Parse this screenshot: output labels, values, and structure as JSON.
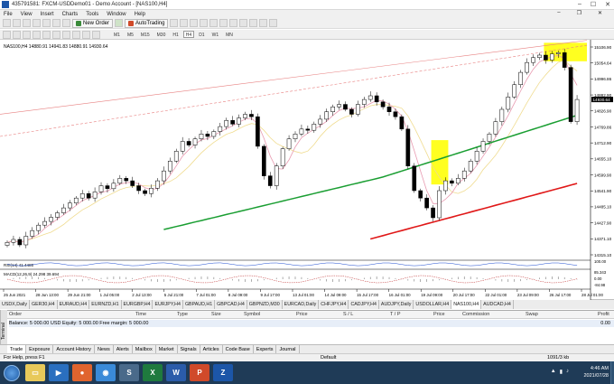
{
  "window": {
    "title": "435791581: FXCM-USDDemo01 - Demo Account - [NAS100,H4]"
  },
  "menu": [
    "File",
    "View",
    "Insert",
    "Charts",
    "Tools",
    "Window",
    "Help"
  ],
  "toolbar": {
    "new_order": "New Order",
    "autotrading": "AutoTrading"
  },
  "timeframes": [
    "M1",
    "M5",
    "M15",
    "M30",
    "H1",
    "H4",
    "D1",
    "W1",
    "MN"
  ],
  "active_timeframe": "H4",
  "chart": {
    "header": "NAS100,H4  14880.91 14941.83 14880.91 14930.64",
    "current_price": "14930.64",
    "y_ticks": [
      "15106.90",
      "15054.64",
      "14996.86",
      "14882.90",
      "14826.90",
      "14769.86",
      "14712.90",
      "14655.10",
      "14599.90",
      "14541.90",
      "14485.10",
      "14427.90",
      "14371.10",
      "14315.10"
    ],
    "osc1_label": "RSI(14) 41.4485",
    "osc2_label": "MACD(12,26,9) 24.298 39.694",
    "osc_ticks": [
      "100.00",
      "85.343",
      "0.00",
      "-84.98"
    ],
    "x_ticks": [
      "25 Jun 2021",
      "28 Jun 13:00",
      "29 Jun 21:00",
      "1 Jul 05:00",
      "2 Jul 13:00",
      "5 Jul 21:00",
      "7 Jul 01:00",
      "8 Jul 09:00",
      "9 Jul 17:00",
      "13 Jul 01:00",
      "14 Jul 09:00",
      "15 Jul 17:00",
      "16 Jul 01:00",
      "19 Jul 09:00",
      "20 Jul 17:00",
      "22 Jul 01:00",
      "23 Jul 09:00",
      "26 Jul 17:00",
      "28 Jul 01:00"
    ],
    "colors": {
      "bull": "#ffffff",
      "bear": "#000000",
      "ma_green": "#1a9e32",
      "ma_red": "#e01818",
      "ma_pink": "#e89ab0",
      "ma_yellow": "#f0dc90",
      "highlight": "#ffff20"
    }
  },
  "chart_data": {
    "type": "candlestick",
    "symbol": "NAS100",
    "timeframe": "H4",
    "ylim": [
      14285,
      15165
    ],
    "closes": [
      14350,
      14362,
      14340,
      14375,
      14398,
      14420,
      14435,
      14452,
      14470,
      14490,
      14510,
      14530,
      14548,
      14530,
      14555,
      14580,
      14568,
      14590,
      14610,
      14600,
      14580,
      14560,
      14548,
      14570,
      14600,
      14640,
      14680,
      14720,
      14760,
      14745,
      14770,
      14790,
      14780,
      14800,
      14820,
      14845,
      14830,
      14855,
      14870,
      14860,
      14740,
      14620,
      14580,
      14660,
      14730,
      14770,
      14790,
      14810,
      14805,
      14830,
      14850,
      14880,
      14900,
      14910,
      14890,
      14870,
      14910,
      14930,
      14945,
      14920,
      14900,
      14880,
      14860,
      14810,
      14660,
      14560,
      14530,
      14490,
      14450,
      14560,
      14600,
      14590,
      14610,
      14640,
      14680,
      14720,
      14760,
      14790,
      14840,
      14890,
      14940,
      14990,
      15040,
      15080,
      15100,
      15110,
      15090,
      15115,
      15120,
      15060,
      14840,
      14930
    ]
  },
  "symbol_tabs": [
    "USDX,Daily",
    "GER30,H4",
    "EURAUD,H4",
    "EURNZD,H1",
    "EURGBP,H4",
    "EURJPY,H4",
    "GBPAUD,H1",
    "GBPCAD,H4",
    "GBPNZD,M30",
    "EURCAD,Daily",
    "CHFJPY,H4",
    "CADJPY,H4",
    "AUDJPY,Daily",
    "USDOLLAR,H4",
    "NAS100,H4",
    "AUDCAD,H4"
  ],
  "active_symbol_tab": "NAS100,H4",
  "terminal": {
    "columns": [
      "Order",
      "Time",
      "Type",
      "Size",
      "Symbol",
      "Price",
      "S / L",
      "T / P",
      "Price",
      "Commission",
      "Swap",
      "Profit"
    ],
    "balance_text": "Balance: 5 000.00 USD  Equity: 5 000.00  Free margin: 5 000.00",
    "balance_value": "0.00",
    "tabs": [
      "Trade",
      "Exposure",
      "Account History",
      "News",
      "Alerts",
      "Mailbox",
      "Market",
      "Signals",
      "Articles",
      "Code Base",
      "Experts",
      "Journal"
    ],
    "toolbox_label": "Terminal"
  },
  "status": {
    "help": "For Help, press F1",
    "profile": "Default",
    "traffic": "1091/3 kb"
  },
  "taskbar": {
    "time": "4:46 AM",
    "date": "2021/07/28"
  }
}
